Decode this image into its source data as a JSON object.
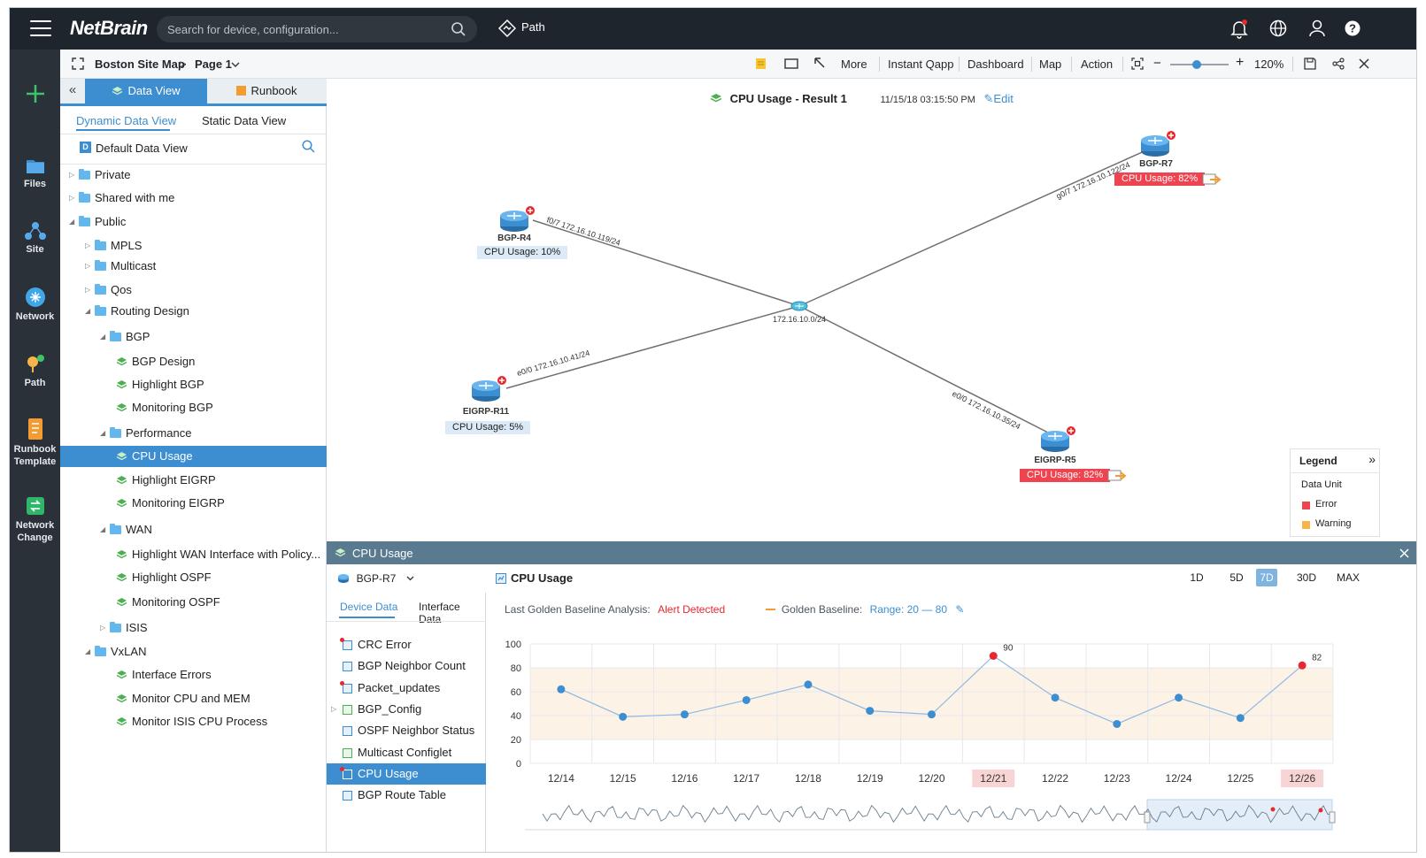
{
  "app": {
    "logo": "NetBrain",
    "search_placeholder": "Search for device, configuration...",
    "path_label": "Path"
  },
  "rail": [
    {
      "label": "Files"
    },
    {
      "label": "Site"
    },
    {
      "label": "Network"
    },
    {
      "label": "Path"
    },
    {
      "label1": "Runbook",
      "label2": "Template"
    },
    {
      "label1": "Network",
      "label2": "Change"
    }
  ],
  "crumbs": {
    "map": "Boston Site Map",
    "page": "Page 1"
  },
  "toolbar": {
    "more": "More",
    "qapp": "Instant Qapp",
    "dashboard": "Dashboard",
    "map": "Map",
    "action": "Action",
    "zoom": "120%",
    "zoom_fraction": 0.45
  },
  "panel": {
    "tab_data": "Data View",
    "tab_runbook": "Runbook",
    "sub_dynamic": "Dynamic Data View",
    "sub_static": "Static Data View",
    "default_view": "Default Data View",
    "default_badge": "D",
    "tree": [
      {
        "label": "Private",
        "kind": "folder",
        "level": 0,
        "state": "closed"
      },
      {
        "label": "Shared with me",
        "kind": "folder",
        "level": 0,
        "state": "closed"
      },
      {
        "label": "Public",
        "kind": "folder",
        "level": 0,
        "state": "open"
      },
      {
        "label": "MPLS",
        "kind": "folder",
        "level": 1,
        "state": "closed"
      },
      {
        "label": "Multicast",
        "kind": "folder",
        "level": 1,
        "state": "closed"
      },
      {
        "label": "Qos",
        "kind": "folder",
        "level": 1,
        "state": "closed"
      },
      {
        "label": "Routing Design",
        "kind": "folder",
        "level": 1,
        "state": "open"
      },
      {
        "label": "BGP",
        "kind": "folder",
        "level": 2,
        "state": "open"
      },
      {
        "label": "BGP Design",
        "kind": "view",
        "level": 3
      },
      {
        "label": "Highlight BGP",
        "kind": "view",
        "level": 3
      },
      {
        "label": "Monitoring BGP",
        "kind": "view",
        "level": 3
      },
      {
        "label": "Performance",
        "kind": "folder",
        "level": 2,
        "state": "open"
      },
      {
        "label": "CPU Usage",
        "kind": "view",
        "level": 3,
        "selected": true
      },
      {
        "label": "Highlight EIGRP",
        "kind": "view",
        "level": 3
      },
      {
        "label": "Monitoring EIGRP",
        "kind": "view",
        "level": 3
      },
      {
        "label": "WAN",
        "kind": "folder",
        "level": 2,
        "state": "open"
      },
      {
        "label": "Highlight WAN Interface with Policy...",
        "kind": "view",
        "level": 3
      },
      {
        "label": "Highlight OSPF",
        "kind": "view",
        "level": 3
      },
      {
        "label": "Monitoring OSPF",
        "kind": "view",
        "level": 3
      },
      {
        "label": "ISIS",
        "kind": "folder",
        "level": 2,
        "state": "closed"
      },
      {
        "label": "VxLAN",
        "kind": "folder",
        "level": 1,
        "state": "open"
      },
      {
        "label": "Interface Errors",
        "kind": "view",
        "level": 3
      },
      {
        "label": "Monitor CPU and MEM",
        "kind": "view",
        "level": 3
      },
      {
        "label": "Monitor ISIS CPU Process",
        "kind": "view",
        "level": 3
      }
    ]
  },
  "map": {
    "result_title": "CPU Usage - Result 1",
    "timestamp": "11/15/18 03:15:50 PM",
    "edit": "Edit",
    "hub_label": "172.16.10.0/24",
    "devices": [
      {
        "name": "BGP-R4",
        "cpu": "CPU Usage: 10%",
        "status": "ok"
      },
      {
        "name": "BGP-R7",
        "cpu": "CPU Usage: 82%",
        "status": "error"
      },
      {
        "name": "EIGRP-R11",
        "cpu": "CPU Usage: 5%",
        "status": "ok"
      },
      {
        "name": "EIGRP-R5",
        "cpu": "CPU Usage: 82%",
        "status": "error"
      }
    ],
    "links": [
      "f0/7 172.16.10.119/24",
      "g0/7 172.16.10.122/24",
      "e0/0 172.16.10.41/24",
      "e0/0 172.16.10.35/24"
    ],
    "legend": {
      "title": "Legend",
      "section": "Data Unit",
      "items": [
        {
          "label": "Error",
          "color": "#ef4450"
        },
        {
          "label": "Warning",
          "color": "#f5b548"
        }
      ]
    }
  },
  "bottom": {
    "title": "CPU Usage",
    "device": "BGP-R7",
    "chart_title": "CPU Usage",
    "ranges": [
      "1D",
      "5D",
      "7D",
      "30D",
      "MAX"
    ],
    "selected_range": "7D",
    "tabs": {
      "device": "Device Data",
      "interface": "Interface Data"
    },
    "items": [
      {
        "label": "CRC Error",
        "icon": "table",
        "alert": true
      },
      {
        "label": "BGP Neighbor Count",
        "icon": "table"
      },
      {
        "label": "Packet_updates",
        "icon": "table",
        "alert": true
      },
      {
        "label": "BGP_Config",
        "icon": "config",
        "expandable": true
      },
      {
        "label": "OSPF Neighbor Status",
        "icon": "table"
      },
      {
        "label": "Multicast Configlet",
        "icon": "config"
      },
      {
        "label": "CPU Usage",
        "icon": "table",
        "alert": true,
        "selected": true
      },
      {
        "label": "BGP Route Table",
        "icon": "grid"
      }
    ],
    "analysis_label": "Last Golden Baseline Analysis:",
    "alert": "Alert Detected",
    "baseline_label": "Golden Baseline:",
    "range_text": "Range:  20 — 80"
  },
  "chart_data": {
    "type": "line",
    "categories": [
      "12/14",
      "12/15",
      "12/16",
      "12/17",
      "12/18",
      "12/19",
      "12/20",
      "12/21",
      "12/22",
      "12/23",
      "12/24",
      "12/25",
      "12/26"
    ],
    "values": [
      62,
      39,
      41,
      53,
      66,
      44,
      41,
      90,
      55,
      33,
      55,
      38,
      82
    ],
    "alert_points": [
      7,
      12
    ],
    "data_labels": {
      "7": "90",
      "12": "82"
    },
    "baseline_range": [
      20,
      80
    ],
    "ylim": [
      0,
      100
    ],
    "yticks": [
      0,
      20,
      40,
      60,
      80,
      100
    ],
    "grid": true,
    "colors": {
      "line": "#8fb9e4",
      "point": "#3d8ed0",
      "alert": "#e8282f",
      "band": "#fdf2e6"
    }
  }
}
